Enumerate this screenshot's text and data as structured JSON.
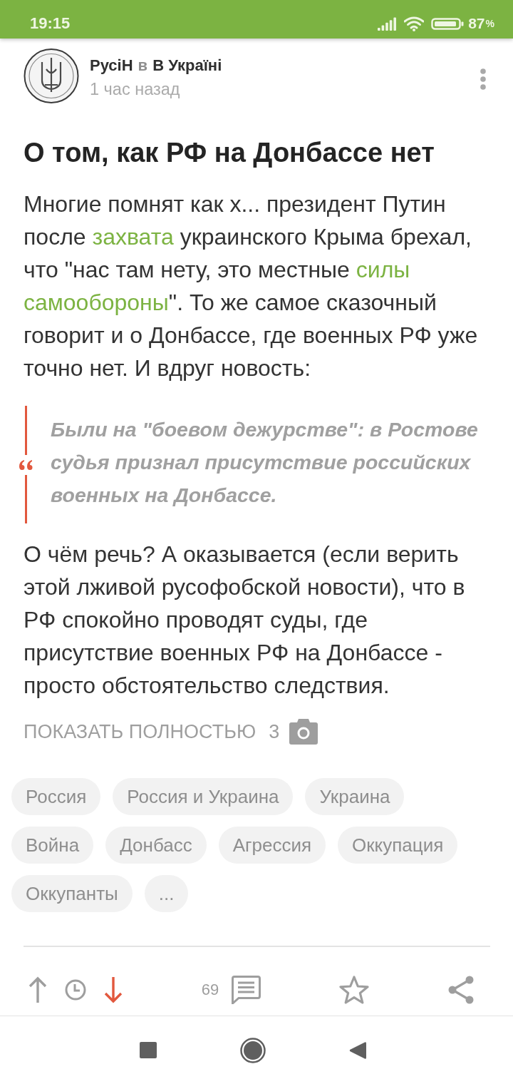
{
  "status_bar": {
    "time": "19:15",
    "battery_text": "87",
    "battery_unit": "%"
  },
  "post": {
    "author": "РусіН",
    "preposition": "в",
    "community": "В Україні",
    "time": "1 час назад",
    "title": "О том, как РФ на Донбассе нет",
    "blocks": [
      {
        "kind": "paragraph",
        "parts": [
          {
            "kind": "text",
            "text": "Многие помнят как х... президент Путин после "
          },
          {
            "kind": "link",
            "text": "захвата"
          },
          {
            "kind": "text",
            "text": " украинского Крыма брехал, что \"нас там нету, это местные "
          },
          {
            "kind": "link",
            "text": "силы"
          },
          {
            "kind": "link",
            "text": "самообороны"
          },
          {
            "kind": "text",
            "text": "\". То же самое сказочный говорит и о Донбассе, где военных РФ уже точно нет. И вдруг новость:"
          }
        ]
      },
      {
        "kind": "quote",
        "text": "Были на \"боевом дежурстве\": в Ростове судья признал присутствие российских военных на Донбассе."
      },
      {
        "kind": "paragraph",
        "parts": [
          {
            "kind": "text",
            "text": "О чём речь? А оказывается (если верить этой лживой русофобской новости), что в РФ спокойно проводят суды, где присутствие военных РФ на Донбассе - просто обстоятельство следствия."
          }
        ]
      }
    ],
    "show_more": {
      "label": "ПОКАЗАТЬ ПОЛНОСТЬЮ",
      "image_count": "3"
    },
    "tags": [
      {
        "label": "Россия"
      },
      {
        "label": "Россия и Украина"
      },
      {
        "label": "Украина"
      },
      {
        "label": "Война"
      },
      {
        "label": "Донбасс"
      },
      {
        "label": "Агрессия"
      },
      {
        "label": "Оккупация"
      },
      {
        "label": "Оккупанты"
      }
    ],
    "more_tags": {
      "label": "..."
    },
    "actions": {
      "upvote_selected": false,
      "rating_hidden": true,
      "downvote_selected": true,
      "comments_count": "69",
      "saved": false
    }
  }
}
